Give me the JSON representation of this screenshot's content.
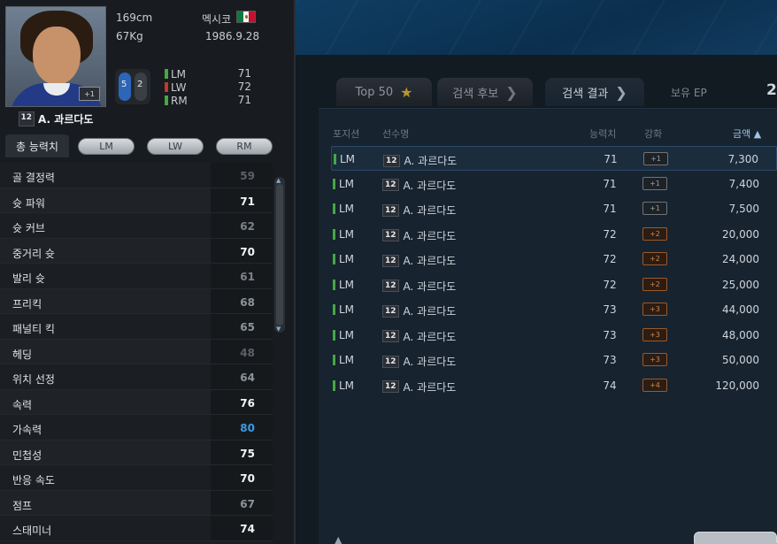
{
  "player": {
    "name": "A. 과르다도",
    "season_badge": "12",
    "photo_tag": "+1",
    "height": "169cm",
    "weight": "67Kg",
    "nation": "멕시코",
    "birthdate": "1986.9.28",
    "left_foot": "5",
    "right_foot": "2",
    "positions": [
      {
        "pos": "LM",
        "value": "71",
        "color": "#45a844"
      },
      {
        "pos": "LW",
        "value": "72",
        "color": "#c0392b"
      },
      {
        "pos": "RM",
        "value": "71",
        "color": "#45a844"
      }
    ]
  },
  "stat_tabs": {
    "main": "총 능력치",
    "pills": [
      "LM",
      "LW",
      "RM"
    ]
  },
  "stats": [
    {
      "label": "골 결정력",
      "value": "59",
      "color": "#5c6167"
    },
    {
      "label": "슛 파워",
      "value": "71",
      "color": "#f2f4f6"
    },
    {
      "label": "슛 커브",
      "value": "62",
      "color": "#7d8389"
    },
    {
      "label": "중거리 슛",
      "value": "70",
      "color": "#f2f4f6"
    },
    {
      "label": "발리 슛",
      "value": "61",
      "color": "#7d8389"
    },
    {
      "label": "프리킥",
      "value": "68",
      "color": "#8d9398"
    },
    {
      "label": "패널티 킥",
      "value": "65",
      "color": "#8d9398"
    },
    {
      "label": "헤딩",
      "value": "48",
      "color": "#5c6167"
    },
    {
      "label": "위치 선정",
      "value": "64",
      "color": "#8d9398"
    },
    {
      "label": "속력",
      "value": "76",
      "color": "#f2f4f6"
    },
    {
      "label": "가속력",
      "value": "80",
      "color": "#3d9ae0"
    },
    {
      "label": "민첩성",
      "value": "75",
      "color": "#f2f4f6"
    },
    {
      "label": "반응 속도",
      "value": "70",
      "color": "#f2f4f6"
    },
    {
      "label": "점프",
      "value": "67",
      "color": "#8d9398"
    },
    {
      "label": "스태미너",
      "value": "74",
      "color": "#f2f4f6"
    }
  ],
  "market_tabs": [
    {
      "label": "Top 50",
      "icon": "star-icon"
    },
    {
      "label": "검색 후보",
      "icon": "chevron-right-icon"
    },
    {
      "label": "검색 결과",
      "icon": "chevron-right-icon"
    }
  ],
  "ep": {
    "label": "보유 EP",
    "value": "2"
  },
  "columns": {
    "position": "포지션",
    "player": "선수명",
    "ovr": "능력치",
    "enhance": "강화",
    "price": "금액 ▲"
  },
  "listings": [
    {
      "pos": "LM",
      "season": "12",
      "name": "A. 과르다도",
      "ovr": "71",
      "enh": "+1",
      "enh_level": "low",
      "price": "7,300"
    },
    {
      "pos": "LM",
      "season": "12",
      "name": "A. 과르다도",
      "ovr": "71",
      "enh": "+1",
      "enh_level": "low",
      "price": "7,400"
    },
    {
      "pos": "LM",
      "season": "12",
      "name": "A. 과르다도",
      "ovr": "71",
      "enh": "+1",
      "enh_level": "low",
      "price": "7,500"
    },
    {
      "pos": "LM",
      "season": "12",
      "name": "A. 과르다도",
      "ovr": "72",
      "enh": "+2",
      "enh_level": "mid",
      "price": "20,000"
    },
    {
      "pos": "LM",
      "season": "12",
      "name": "A. 과르다도",
      "ovr": "72",
      "enh": "+2",
      "enh_level": "mid",
      "price": "24,000"
    },
    {
      "pos": "LM",
      "season": "12",
      "name": "A. 과르다도",
      "ovr": "72",
      "enh": "+2",
      "enh_level": "mid",
      "price": "25,000"
    },
    {
      "pos": "LM",
      "season": "12",
      "name": "A. 과르다도",
      "ovr": "73",
      "enh": "+3",
      "enh_level": "mid",
      "price": "44,000"
    },
    {
      "pos": "LM",
      "season": "12",
      "name": "A. 과르다도",
      "ovr": "73",
      "enh": "+3",
      "enh_level": "mid",
      "price": "48,000"
    },
    {
      "pos": "LM",
      "season": "12",
      "name": "A. 과르다도",
      "ovr": "73",
      "enh": "+3",
      "enh_level": "mid",
      "price": "50,000"
    },
    {
      "pos": "LM",
      "season": "12",
      "name": "A. 과르다도",
      "ovr": "74",
      "enh": "+4",
      "enh_level": "mid",
      "price": "120,000"
    }
  ]
}
